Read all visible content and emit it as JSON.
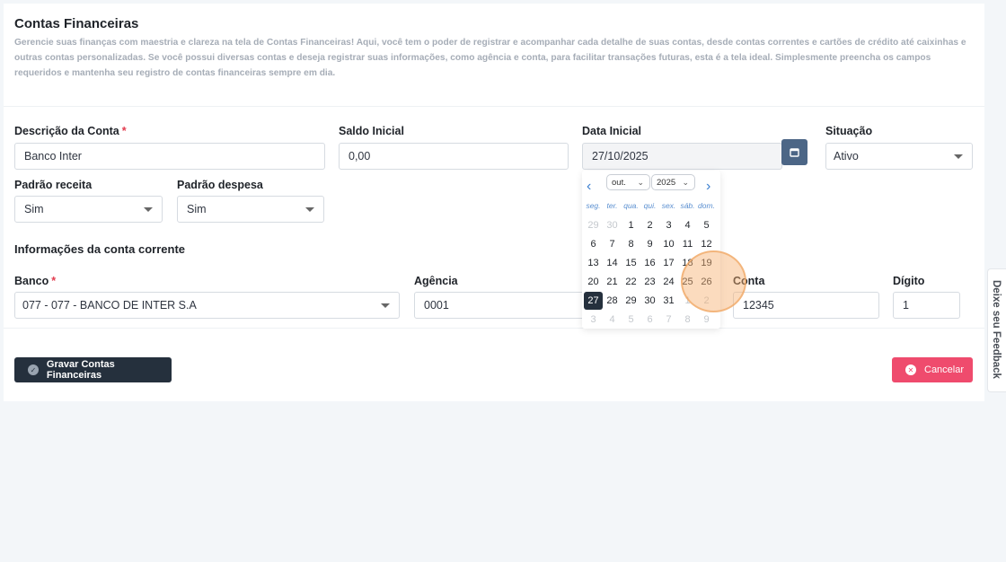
{
  "page": {
    "title": "Contas Financeiras",
    "description": "Gerencie suas finanças com maestria e clareza na tela de Contas Financeiras! Aqui, você tem o poder de registrar e acompanhar cada detalhe de suas contas, desde contas correntes e cartões de crédito até caixinhas e outras contas personalizadas. Se você possui diversas contas e deseja registrar suas informações, como agência e conta, para facilitar transações futuras, esta é a tela ideal. Simplesmente preencha os campos requeridos e mantenha seu registro de contas financeiras sempre em dia."
  },
  "form": {
    "descricao": {
      "label": "Descrição da Conta",
      "required": "*",
      "value": "Banco Inter"
    },
    "saldo": {
      "label": "Saldo Inicial",
      "value": "0,00"
    },
    "data": {
      "label": "Data Inicial",
      "value": "27/10/2025"
    },
    "situacao": {
      "label": "Situação",
      "value": "Ativo"
    },
    "padrao_receita": {
      "label": "Padrão receita",
      "value": "Sim"
    },
    "padrao_despesa": {
      "label": "Padrão despesa",
      "value": "Sim"
    },
    "section_title": "Informações da conta corrente",
    "banco": {
      "label": "Banco",
      "required": "*",
      "value": "077 - 077 - BANCO DE INTER S.A"
    },
    "agencia": {
      "label": "Agência",
      "value": "0001"
    },
    "conta": {
      "label": "Conta",
      "value": "12345"
    },
    "digito": {
      "label": "Dígito",
      "value": "1"
    }
  },
  "buttons": {
    "save": "Gravar Contas Financeiras",
    "cancel": "Cancelar"
  },
  "datepicker": {
    "month": "out.",
    "year": "2025",
    "prev": "‹",
    "next": "›",
    "weekdays": [
      "seg.",
      "ter.",
      "qua.",
      "qui.",
      "sex.",
      "sáb.",
      "dom."
    ],
    "weeks": [
      [
        {
          "d": "29",
          "o": true
        },
        {
          "d": "30",
          "o": true
        },
        {
          "d": "1"
        },
        {
          "d": "2"
        },
        {
          "d": "3"
        },
        {
          "d": "4"
        },
        {
          "d": "5"
        }
      ],
      [
        {
          "d": "6"
        },
        {
          "d": "7"
        },
        {
          "d": "8"
        },
        {
          "d": "9"
        },
        {
          "d": "10"
        },
        {
          "d": "11"
        },
        {
          "d": "12"
        }
      ],
      [
        {
          "d": "13"
        },
        {
          "d": "14"
        },
        {
          "d": "15"
        },
        {
          "d": "16"
        },
        {
          "d": "17"
        },
        {
          "d": "18"
        },
        {
          "d": "19"
        }
      ],
      [
        {
          "d": "20"
        },
        {
          "d": "21"
        },
        {
          "d": "22"
        },
        {
          "d": "23"
        },
        {
          "d": "24"
        },
        {
          "d": "25"
        },
        {
          "d": "26"
        }
      ],
      [
        {
          "d": "27",
          "s": true
        },
        {
          "d": "28"
        },
        {
          "d": "29"
        },
        {
          "d": "30"
        },
        {
          "d": "31"
        },
        {
          "d": "1",
          "o": true
        },
        {
          "d": "2",
          "o": true
        }
      ],
      [
        {
          "d": "3",
          "o": true
        },
        {
          "d": "4",
          "o": true
        },
        {
          "d": "5",
          "o": true
        },
        {
          "d": "6",
          "o": true
        },
        {
          "d": "7",
          "o": true
        },
        {
          "d": "8",
          "o": true
        },
        {
          "d": "9",
          "o": true
        }
      ]
    ]
  },
  "feedback_tab": "Deixe seu Feedback",
  "colors": {
    "primary": "#25303d",
    "calendar_button": "#4c6686",
    "danger": "#ef4b6d",
    "link": "#3c7fd0",
    "highlight": "#f6b06e"
  }
}
